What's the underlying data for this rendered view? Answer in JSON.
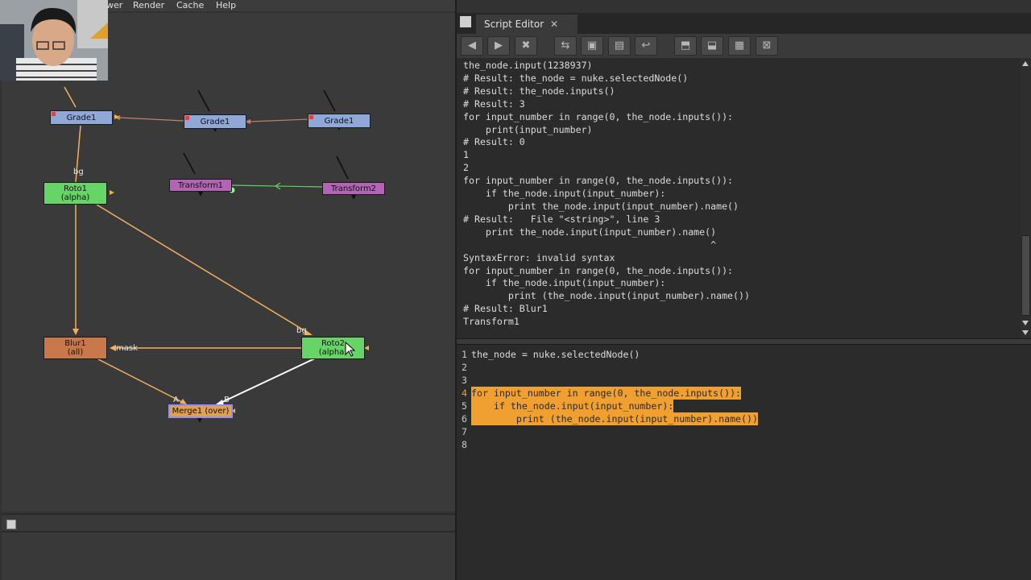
{
  "menu": {
    "items": [
      "wer",
      "Render",
      "Cache",
      "Help"
    ]
  },
  "script_editor": {
    "tab_label": "Script Editor",
    "tab_close": "✕",
    "toolbar": [
      {
        "icon": "previous-script-icon",
        "glyph": "◀"
      },
      {
        "icon": "next-script-icon",
        "glyph": "▶"
      },
      {
        "icon": "clear-history-icon",
        "glyph": "✖"
      },
      {
        "icon": "source-script-icon",
        "glyph": "⇆"
      },
      {
        "icon": "load-script-icon",
        "glyph": "▣"
      },
      {
        "icon": "save-script-icon",
        "glyph": "▤"
      },
      {
        "icon": "run-script-icon",
        "glyph": "↩"
      },
      {
        "icon": "show-input-only-icon",
        "glyph": "⬒"
      },
      {
        "icon": "show-output-only-icon",
        "glyph": "⬓"
      },
      {
        "icon": "show-both-icon",
        "glyph": "▦"
      },
      {
        "icon": "clear-output-icon",
        "glyph": "⊠"
      }
    ],
    "output_text": "the_node.input(1238937)\n# Result: the_node = nuke.selectedNode()\n# Result: the_node.inputs()\n# Result: 3\nfor input_number in range(0, the_node.inputs()):\n    print(input_number)\n# Result: 0\n1\n2\nfor input_number in range(0, the_node.inputs()):\n    if the_node.input(input_number):\n        print the_node.input(input_number).name()\n# Result:   File \"<string>\", line 3\n    print the_node.input(input_number).name()\n                                            ^\nSyntaxError: invalid syntax\nfor input_number in range(0, the_node.inputs()):\n    if the_node.input(input_number):\n        print (the_node.input(input_number).name())\n# Result: Blur1\nTransform1",
    "input_lines": [
      {
        "num": "1",
        "text": "the_node = nuke.selectedNode()",
        "selected": false,
        "current": false
      },
      {
        "num": "2",
        "text": "",
        "selected": false,
        "current": false
      },
      {
        "num": "3",
        "text": "",
        "selected": false,
        "current": false
      },
      {
        "num": "4",
        "text": "for input_number in range(0, the_node.inputs()):",
        "selected": true,
        "current": true
      },
      {
        "num": "5",
        "text": "    if the_node.input(input_number):",
        "selected": true,
        "current": false
      },
      {
        "num": "6",
        "text": "        print (the_node.input(input_number).name())",
        "selected": true,
        "current": false
      },
      {
        "num": "7",
        "text": "",
        "selected": false,
        "current": false
      },
      {
        "num": "8",
        "text": "",
        "selected": false,
        "current": false
      }
    ]
  },
  "node_graph": {
    "nodes": [
      {
        "id": "grade1-a",
        "label": "Grade1",
        "sub": "",
        "kind": "grade"
      },
      {
        "id": "grade1-b",
        "label": "Grade1",
        "sub": "",
        "kind": "grade"
      },
      {
        "id": "grade1-c",
        "label": "Grade1",
        "sub": "",
        "kind": "grade"
      },
      {
        "id": "roto1",
        "label": "Roto1",
        "sub": "(alpha)",
        "kind": "roto"
      },
      {
        "id": "transform1",
        "label": "Transform1",
        "sub": "",
        "kind": "xform"
      },
      {
        "id": "transform2",
        "label": "Transform2",
        "sub": "",
        "kind": "xform"
      },
      {
        "id": "blur1",
        "label": "Blur1",
        "sub": "(all)",
        "kind": "blur"
      },
      {
        "id": "roto2",
        "label": "Roto2",
        "sub": "(alpha)",
        "kind": "roto"
      },
      {
        "id": "merge1",
        "label": "Merge1 (over)",
        "sub": "",
        "kind": "merge"
      }
    ],
    "edge_labels": {
      "bg1": "bg",
      "bg2": "bg",
      "mask": "mask",
      "A": "A",
      "B": "B"
    },
    "colors": {
      "pipe_orange": "#f0b060",
      "pipe_white": "#ffffff",
      "pipe_green": "#66cc66",
      "pipe_brown": "#c08070",
      "selection_orange": "#f0a030"
    }
  }
}
